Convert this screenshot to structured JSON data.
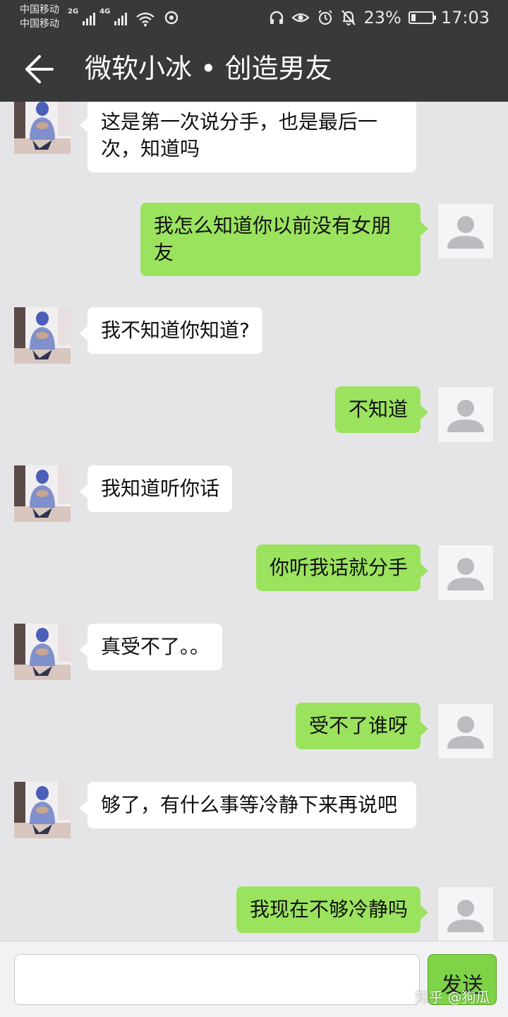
{
  "status_bar": {
    "carrier_1": "中国移动",
    "carrier_2": "中国移动",
    "network_1": "2G",
    "network_2": "4G",
    "battery": "23%",
    "battery_level": 0.23,
    "time": "17:03",
    "icons": [
      "signal-icon",
      "wifi-icon",
      "sync-icon",
      "headset-icon",
      "eye-icon",
      "alarm-icon",
      "bell-off-icon",
      "battery-icon"
    ]
  },
  "header": {
    "back_icon": "arrow-left-icon",
    "title": "微软小冰 • 创造男友"
  },
  "messages": [
    {
      "from": "bot",
      "text": "这是第一次说分手，也是最后一次，知道吗"
    },
    {
      "from": "user",
      "text": "我怎么知道你以前没有女朋友"
    },
    {
      "from": "bot",
      "text": "我不知道你知道?"
    },
    {
      "from": "user",
      "text": "不知道"
    },
    {
      "from": "bot",
      "text": "我知道听你话"
    },
    {
      "from": "user",
      "text": "你听我话就分手"
    },
    {
      "from": "bot",
      "text": "真受不了。。"
    },
    {
      "from": "user",
      "text": "受不了谁呀"
    },
    {
      "from": "bot",
      "text": "够了，有什么事等冷静下来再说吧"
    },
    {
      "from": "user",
      "text": "我现在不够冷静吗"
    }
  ],
  "input_bar": {
    "input_value": "",
    "placeholder": "",
    "send_label": "发送"
  },
  "watermark": "知乎 @狗瓜",
  "colors": {
    "header_bg": "#38393b",
    "chat_bg": "#e5e5e7",
    "user_bubble": "#9be35e",
    "bot_bubble": "#ffffff",
    "send_button": "#7ed347"
  }
}
